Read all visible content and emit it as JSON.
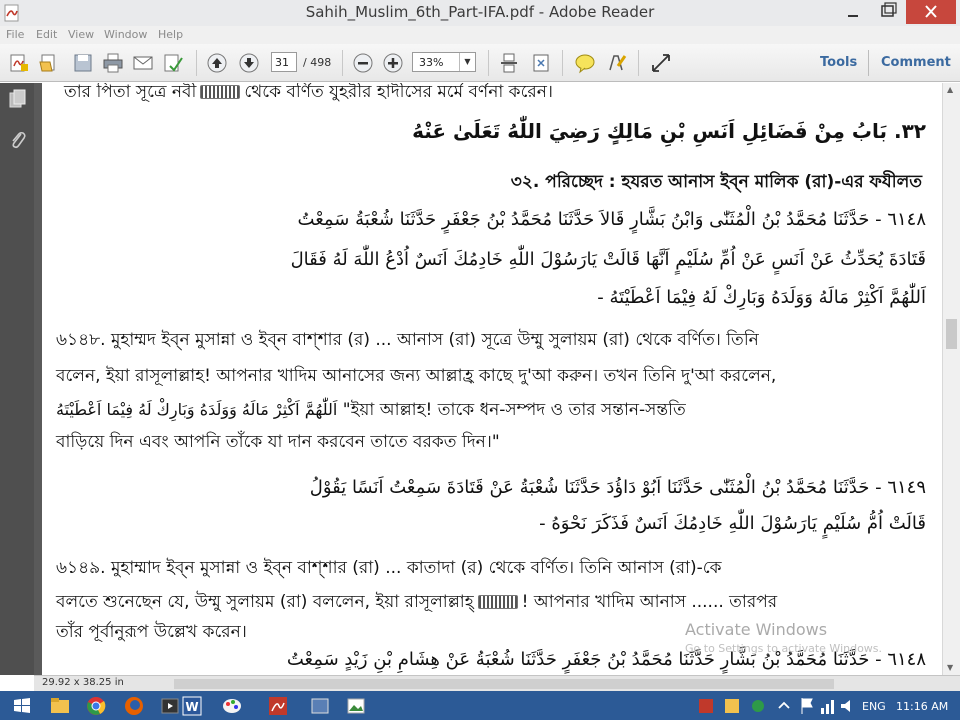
{
  "window": {
    "title": "Sahih_Muslim_6th_Part-IFA.pdf - Adobe Reader"
  },
  "menu": [
    "File",
    "Edit",
    "View",
    "Window",
    "Help"
  ],
  "toolbar": {
    "page_current": "31",
    "page_total": "/ 498",
    "zoom": "33%",
    "tools_label": "Tools",
    "comment_label": "Comment"
  },
  "document": {
    "lines": [
      "তার পিতা  সূত্রে নবী",
      "থেকে বর্ণিত যুহরীর হাদীসের মর্মে বর্ণনা করেন।",
      "٣٢. بَابُ مِنْ فَضَائِلِ اَنَسِ بْنِ مَالِكٍ رَضِيَ اللّٰهُ  تَعَلَىٰ عَنْهُ",
      "৩২.  পরিচ্ছেদ : হযরত আনাস ইব্ন মালিক (রা)-এর ফযীলত",
      "٦١٤٨ - حَدَّثَنَا مُحَمَّدُ بْنُ الْمُثَنّٰى وَابْنُ بَشَّارٍ قَالاَ حَدَّثَنَا مُحَمَّدُ بْنُ جَعْفَرٍ حَدَّثَنَا شُعْبَةُ سَمِعْتُ",
      "قَتَادَةَ يُحَدِّثُ عَنْ اَنَسٍ عَنْ اُمِّ سُلَيْمٍ اَنَّهَا قَالَتْ يَارَسُوْلَ اللّٰهِ خَادِمُكَ اَنَسٌ اُدْعُ اللّٰهَ لَهُ فَقَالَ",
      "اَللّٰهُمَّ اَكْثِرْ مَالَهُ وَوَلَدَهُ وَبَارِكْ لَهُ فِيْمَا اَعْطَيْتَهُ -",
      "৬১৪৮.  মুহাম্মদ ইব্ন মুসান্না ও ইব্ন বাশ্শার (র) ... আনাস (রা) সূত্রে উম্মু সুলায়ম (রা) থেকে বর্ণিত। তিনি",
      "বলেন, ইয়া রাসূলাল্লাহ!  আপনার খাদিম আনাসের জন্য আল্লাহ্র  কাছে দু'আ করুন। তখন তিনি দু'আ করলেন,",
      "اَللّٰهُمَّ اَكْثِرْ مَالَهُ وَوَلَدَهُ وَبَارِكْ لَهُ فِيْمَا اَعْطَيْتَهُ",
      "\"ইয়া আল্লাহ! তাকে ধন-সম্পদ ও তার সন্তান-সন্ততি",
      "বাড়িয়ে দিন এবং আপনি তাঁকে যা দান করবেন তাতে বরকত দিন।\"",
      "٦١٤٩ - حَدَّثَنَا مُحَمَّدُ بْنُ الْمُثَنّٰى حَدَّثَنَا اَبُوْ دَاؤُدَ حَدَّثَنَا شُعْبَةُ عَنْ قَتَادَةَ سَمِعْتُ اَنَسًا يَقُوْلُ",
      "قَالَتْ اُمُّ سُلَيْمٍ يَارَسُوْلَ اللّٰهِ خَادِمُكَ اَنَسٌ فَذَكَرَ نَحْوَهُ -",
      "৬১৪৯.  মুহাম্মাদ ইব্ন মুসান্না ও ইব্ন বাশ্শার (রা) ... কাতাদা (র) থেকে বর্ণিত। তিনি আনাস (রা)-কে",
      "বলতে শুনেছেন যে, উম্মু সুলায়ম (রা) বললেন, ইয়া রাসূলাল্লাহ্",
      "! আপনার খাদিম আনাস ...... তারপর",
      "তাঁর পূর্বানুরূপ উল্লেখ করেন।",
      "٦١٤٨ - حَدَّثَنَا مُحَمَّدُ بْنُ بَشَّارٍ حَدَّثَنَا مُحَمَّدُ بْنُ جَعْفَرٍ حَدَّثَنَا شُعْبَةُ عَنْ هِشَامِ بْنِ زَيْدٍ سَمِعْتُ"
    ]
  },
  "watermark": {
    "line1": "Activate Windows",
    "line2": "Go to Settings to activate Windows."
  },
  "status": {
    "page_size": "29.92 x 38.25 in"
  },
  "taskbar": {
    "language": "ENG",
    "time": "11:16 AM"
  }
}
